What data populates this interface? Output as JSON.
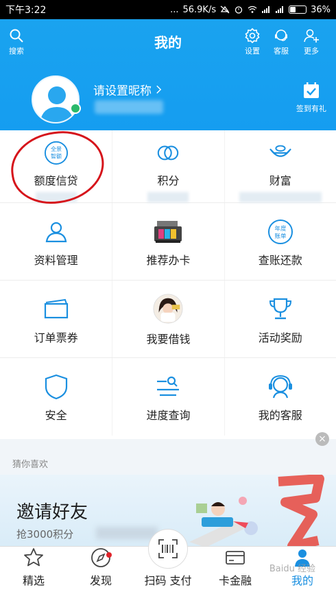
{
  "status_bar": {
    "time": "下午3:22",
    "dots": "...",
    "speed": "56.9K/s",
    "battery_text": "36%",
    "battery_level": 0.36
  },
  "header": {
    "title": "我的",
    "search_label": "搜索",
    "settings_label": "设置",
    "service_label": "客服",
    "more_label": "更多",
    "nickname": "请设置昵称",
    "signin_label": "签到有礼"
  },
  "grid": [
    {
      "label": "额度信贷",
      "icon": "quota-badge-icon",
      "icon_text_1": "全景",
      "icon_text_2": "智额"
    },
    {
      "label": "积分",
      "icon": "points-rings-icon"
    },
    {
      "label": "财富",
      "icon": "ingot-icon"
    },
    {
      "label": "资料管理",
      "icon": "profile-icon"
    },
    {
      "label": "推荐办卡",
      "icon": "card-printer-icon"
    },
    {
      "label": "查账还款",
      "icon": "annual-bill-icon",
      "icon_text_1": "年度",
      "icon_text_2": "账单"
    },
    {
      "label": "订单票券",
      "icon": "ticket-icon"
    },
    {
      "label": "我要借钱",
      "icon": "borrow-avatar-icon"
    },
    {
      "label": "活动奖励",
      "icon": "trophy-icon"
    },
    {
      "label": "安全",
      "icon": "shield-icon"
    },
    {
      "label": "进度查询",
      "icon": "progress-search-icon"
    },
    {
      "label": "我的客服",
      "icon": "headset-icon"
    }
  ],
  "recommend": {
    "title": "猜你喜欢",
    "close": "×",
    "banner_title": "邀请好友",
    "banner_sub": "抢3000积分"
  },
  "bottom_nav": [
    {
      "label": "精选",
      "icon": "star-icon"
    },
    {
      "label": "发现",
      "icon": "compass-icon",
      "badge": true
    },
    {
      "label": "扫码 支付",
      "icon": "scan-icon"
    },
    {
      "label": "卡金融",
      "icon": "card-icon"
    },
    {
      "label": "我的",
      "icon": "person-icon",
      "active": true
    }
  ],
  "watermark": "Baidu 经验",
  "colors": {
    "header_blue": "#159df0",
    "icon_blue": "#1a8fe0",
    "annotation_red": "#d6141b"
  }
}
